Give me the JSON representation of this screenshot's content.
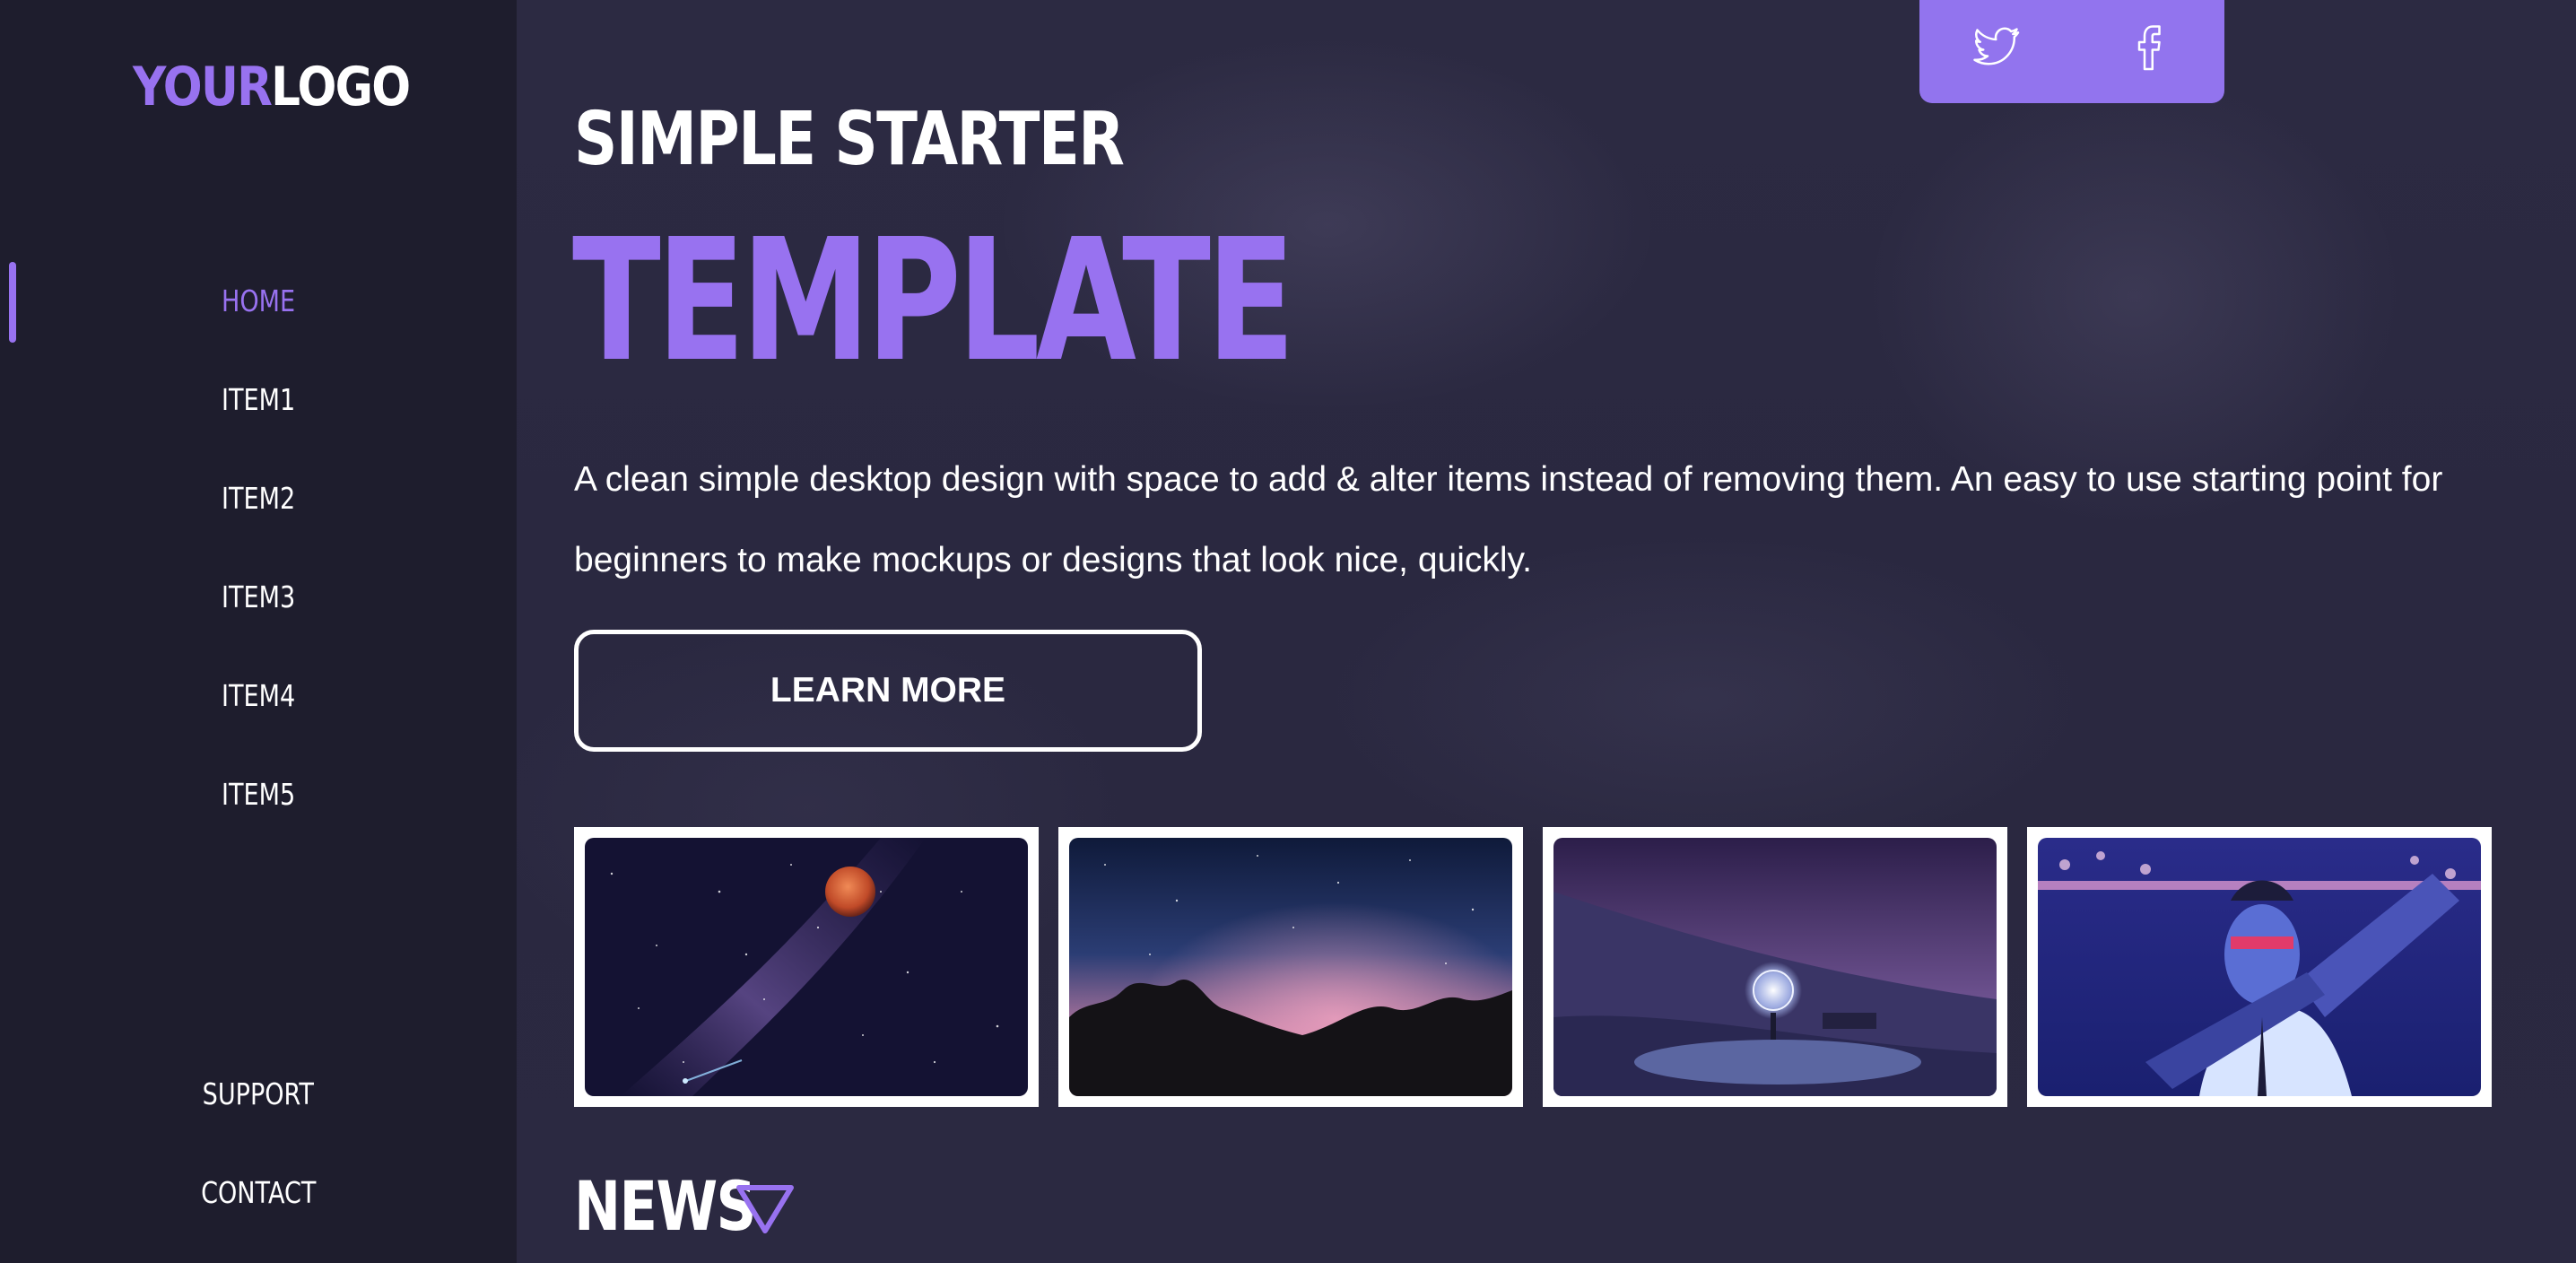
{
  "logo": {
    "part1": "YOUR",
    "part2": "LOGO"
  },
  "sidebar": {
    "items": [
      {
        "label": "HOME",
        "active": true
      },
      {
        "label": "ITEM1"
      },
      {
        "label": "ITEM2"
      },
      {
        "label": "ITEM3"
      },
      {
        "label": "ITEM4"
      },
      {
        "label": "ITEM5"
      }
    ],
    "bottom": [
      {
        "label": "SUPPORT"
      },
      {
        "label": "CONTACT"
      }
    ]
  },
  "social": {
    "icons": [
      "twitter-icon",
      "facebook-icon"
    ]
  },
  "hero": {
    "title_small": "SIMPLE STARTER",
    "title_big": "TEMPLATE",
    "description": "A clean simple desktop design with space to add & alter items instead of removing them. An easy to use starting point for beginners to make mockups or designs that look nice, quickly.",
    "button": "LEARN MORE"
  },
  "gallery": [
    "night-sky-moon",
    "desert-rocks-starry-sky",
    "light-orb-snowy-hill",
    "cyberpunk-figure"
  ],
  "news": {
    "title": "NEWS"
  },
  "colors": {
    "accent": "#9872f0",
    "social_bar": "#9274ee",
    "background": "#2a283f",
    "sidebar": "#1c1b2a"
  }
}
